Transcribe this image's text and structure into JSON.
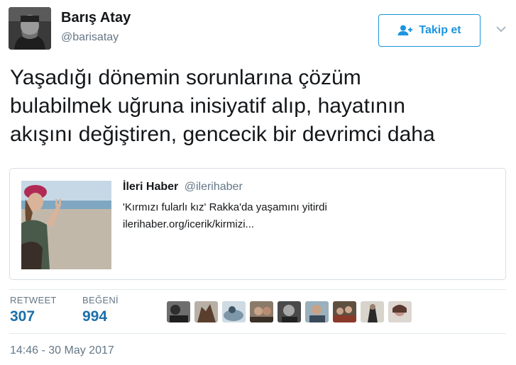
{
  "author": {
    "name": "Barış Atay",
    "handle": "@barisatay"
  },
  "follow_button": {
    "label": "Takip et",
    "icon": "add-user-icon"
  },
  "tweet": {
    "lines": [
      "Yaşadığı dönemin sorunlarına çözüm",
      "bulabilmek uğruna inisiyatif alıp, hayatının",
      "akışını değiştiren, gencecik bir devrimci daha"
    ]
  },
  "quoted_card": {
    "author_name": "İleri Haber",
    "author_handle": "@ilerihaber",
    "text": "'Kırmızı fularlı kız' Rakka'da yaşamını yitirdi",
    "link": "ilerihaber.org/icerik/kirmizi..."
  },
  "stats": {
    "retweet_label": "RETWEET",
    "retweet_count": "307",
    "like_label": "BEĞENİ",
    "like_count": "994"
  },
  "timestamp": "14:46 - 30 May 2017",
  "colors": {
    "accent": "#1b95e0",
    "stat_value": "#1b6fa8",
    "muted": "#657786",
    "border": "#d7dee3"
  }
}
